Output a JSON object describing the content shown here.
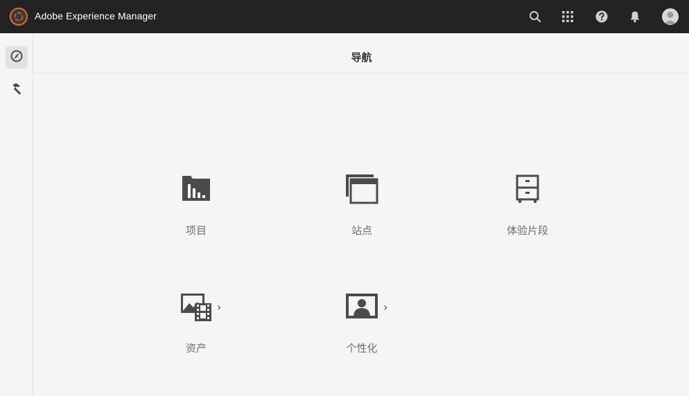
{
  "topbar": {
    "title": "Adobe Experience Manager",
    "logo_icon": "aem-logo-icon",
    "icons": [
      "search-icon",
      "apps-grid-icon",
      "help-icon",
      "bell-icon",
      "avatar"
    ]
  },
  "rail": {
    "items": [
      {
        "icon": "navigation-compass-icon",
        "active": true
      },
      {
        "icon": "tools-hammer-icon",
        "active": false
      }
    ]
  },
  "header": {
    "title": "导航"
  },
  "tiles": [
    {
      "label": "项目",
      "icon": "projects-icon",
      "has_chevron": false
    },
    {
      "label": "站点",
      "icon": "sites-icon",
      "has_chevron": false
    },
    {
      "label": "体验片段",
      "icon": "experience-fragments-icon",
      "has_chevron": false
    },
    {
      "label": "资产",
      "icon": "assets-icon",
      "has_chevron": true
    },
    {
      "label": "个性化",
      "icon": "personalization-icon",
      "has_chevron": true
    }
  ],
  "colors": {
    "topbar_bg": "#232323",
    "brand_accent": "#e8672a",
    "icon_dark": "#4b4b4b",
    "label_gray": "#6e6e6e"
  }
}
